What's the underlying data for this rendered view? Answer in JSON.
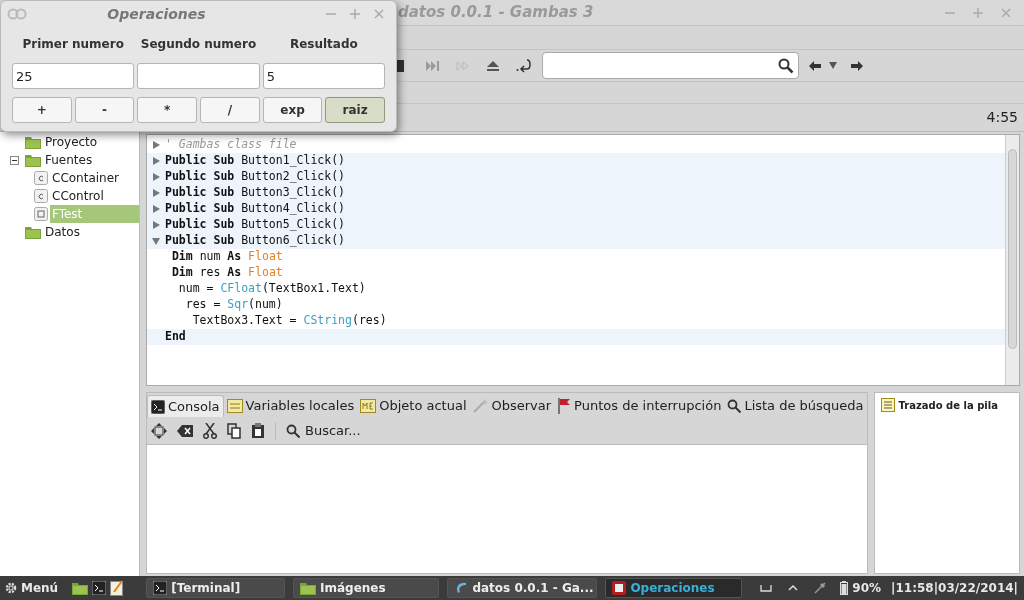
{
  "main_window": {
    "title": "datos 0.0.1 - Gambas 3",
    "position_label": "4:55"
  },
  "project_tree": [
    {
      "label": "Proyecto",
      "kind": "folder",
      "selected": false
    },
    {
      "label": "Fuentes",
      "kind": "folder",
      "selected": false,
      "expanded": true,
      "children": [
        {
          "label": "CContainer",
          "kind": "class",
          "selected": false
        },
        {
          "label": "CControl",
          "kind": "class",
          "selected": false
        },
        {
          "label": "FTest",
          "kind": "form",
          "selected": true
        }
      ]
    },
    {
      "label": "Datos",
      "kind": "folder",
      "selected": false
    }
  ],
  "code_lines": [
    {
      "kind": "collapsed",
      "highlight": false,
      "tokens": [
        {
          "kind": "comment",
          "text": "' Gambas class file"
        }
      ]
    },
    {
      "kind": "collapsed",
      "highlight": true,
      "tokens": [
        {
          "kind": "keyword",
          "text": "Public Sub "
        },
        {
          "kind": "plain",
          "text": "Button1_Click()"
        }
      ]
    },
    {
      "kind": "collapsed",
      "highlight": true,
      "tokens": [
        {
          "kind": "keyword",
          "text": "Public Sub "
        },
        {
          "kind": "plain",
          "text": "Button2_Click()"
        }
      ]
    },
    {
      "kind": "collapsed",
      "highlight": true,
      "tokens": [
        {
          "kind": "keyword",
          "text": "Public Sub "
        },
        {
          "kind": "plain",
          "text": "Button3_Click()"
        }
      ]
    },
    {
      "kind": "collapsed",
      "highlight": true,
      "tokens": [
        {
          "kind": "keyword",
          "text": "Public Sub "
        },
        {
          "kind": "plain",
          "text": "Button4_Click()"
        }
      ]
    },
    {
      "kind": "collapsed",
      "highlight": true,
      "tokens": [
        {
          "kind": "keyword",
          "text": "Public Sub "
        },
        {
          "kind": "plain",
          "text": "Button5_Click()"
        }
      ]
    },
    {
      "kind": "expanded",
      "highlight": true,
      "tokens": [
        {
          "kind": "keyword",
          "text": "Public Sub "
        },
        {
          "kind": "plain",
          "text": "Button6_Click()"
        }
      ]
    },
    {
      "kind": "plain",
      "highlight": false,
      "tokens": [
        {
          "kind": "keyword",
          "text": " Dim "
        },
        {
          "kind": "plain",
          "text": "num "
        },
        {
          "kind": "keyword",
          "text": "As "
        },
        {
          "kind": "type",
          "text": "Float"
        }
      ]
    },
    {
      "kind": "plain",
      "highlight": false,
      "tokens": [
        {
          "kind": "keyword",
          "text": " Dim "
        },
        {
          "kind": "plain",
          "text": "res "
        },
        {
          "kind": "keyword",
          "text": "As "
        },
        {
          "kind": "type",
          "text": "Float"
        }
      ]
    },
    {
      "kind": "plain",
      "highlight": false,
      "tokens": [
        {
          "kind": "plain",
          "text": "  num = "
        },
        {
          "kind": "function",
          "text": "CFloat"
        },
        {
          "kind": "plain",
          "text": "(TextBox1.Text)"
        }
      ]
    },
    {
      "kind": "plain",
      "highlight": false,
      "tokens": [
        {
          "kind": "plain",
          "text": "   res = "
        },
        {
          "kind": "function",
          "text": "Sqr"
        },
        {
          "kind": "plain",
          "text": "(num)"
        }
      ]
    },
    {
      "kind": "plain",
      "highlight": false,
      "tokens": [
        {
          "kind": "plain",
          "text": "    TextBox3.Text = "
        },
        {
          "kind": "function",
          "text": "CString"
        },
        {
          "kind": "plain",
          "text": "(res)"
        }
      ]
    },
    {
      "kind": "plain",
      "highlight": true,
      "tokens": [
        {
          "kind": "keyword",
          "text": "End"
        }
      ]
    }
  ],
  "debug_tabs": [
    {
      "label": "Consola",
      "selected": true
    },
    {
      "label": "Variables locales",
      "selected": false
    },
    {
      "label": "Objeto actual",
      "selected": false
    },
    {
      "label": "Observar",
      "selected": false
    },
    {
      "label": "Puntos de interrupción",
      "selected": false
    },
    {
      "label": "Lista de búsqueda",
      "selected": false
    }
  ],
  "console_toolbar": {
    "search_label": "Buscar..."
  },
  "stack_panel": {
    "title": "Trazado de la pila"
  },
  "dialog": {
    "title": "Operaciones",
    "columns": [
      {
        "label": "Primer numero",
        "value": "25"
      },
      {
        "label": "Segundo numero"
      },
      {
        "label": "Resultado",
        "value": "5"
      }
    ],
    "buttons": [
      {
        "label": "+",
        "selected": false
      },
      {
        "label": "-",
        "selected": false
      },
      {
        "label": "*",
        "selected": false
      },
      {
        "label": "/",
        "selected": false
      },
      {
        "label": "exp",
        "selected": false
      },
      {
        "label": "raiz",
        "selected": true
      }
    ]
  },
  "taskbar": {
    "menu_label": "Menú",
    "tasks": [
      {
        "label": "[Terminal]",
        "selected": false
      },
      {
        "label": "Imágenes",
        "selected": false
      },
      {
        "label": "datos 0.0.1 - Ga...",
        "selected": false
      },
      {
        "label": "Operaciones",
        "selected": true
      }
    ],
    "battery": "90%",
    "clock": "|11:58|03/22/2014|"
  }
}
